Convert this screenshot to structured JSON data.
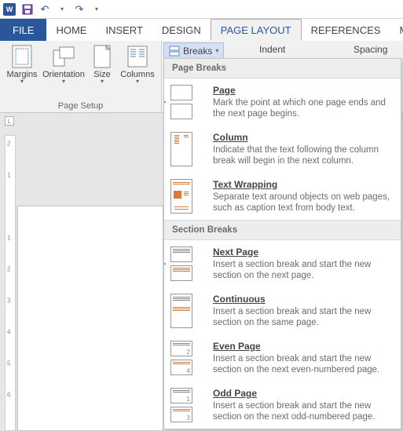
{
  "qat": {
    "undo_tip": "Undo",
    "redo_tip": "Redo",
    "save_tip": "Save"
  },
  "tabs": {
    "file": "FILE",
    "home": "HOME",
    "insert": "INSERT",
    "design": "DESIGN",
    "page_layout": "PAGE LAYOUT",
    "references": "REFERENCES",
    "mailings": "MAILIN"
  },
  "page_setup": {
    "caption": "Page Setup",
    "margins": "Margins",
    "orientation": "Orientation",
    "size": "Size",
    "columns": "Columns",
    "breaks": "Breaks"
  },
  "para": {
    "indent": "Indent",
    "spacing": "Spacing"
  },
  "breaks_menu": {
    "header_page": "Page Breaks",
    "header_section": "Section Breaks",
    "page": {
      "title": "Page",
      "desc": "Mark the point at which one page ends and the next page begins."
    },
    "column": {
      "title": "Column",
      "desc": "Indicate that the text following the column break will begin in the next column."
    },
    "text_wrapping": {
      "title": "Text Wrapping",
      "desc": "Separate text around objects on web pages, such as caption text from body text."
    },
    "next_page": {
      "title": "Next Page",
      "desc": "Insert a section break and start the new section on the next page."
    },
    "continuous": {
      "title": "Continuous",
      "desc": "Insert a section break and start the new section on the same page."
    },
    "even_page": {
      "title": "Even Page",
      "desc": "Insert a section break and start the new section on the next even-numbered page."
    },
    "odd_page": {
      "title": "Odd Page",
      "desc": "Insert a section break and start the new section on the next odd-numbered page."
    }
  },
  "ruler": {
    "marks": [
      "2",
      "1",
      "",
      "1",
      "2",
      "3",
      "4",
      "5",
      "6"
    ]
  }
}
